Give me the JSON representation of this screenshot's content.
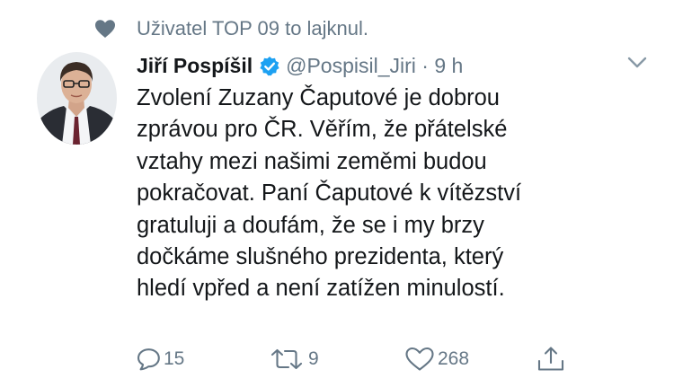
{
  "social_context": {
    "icon": "heart-icon",
    "text": "Uživatel TOP 09 to lajknul."
  },
  "tweet": {
    "author": {
      "display_name": "Jiří Pospíšil",
      "verified": true,
      "handle_time": "@Pospisil_Jiri · 9 h",
      "avatar": "avatar-photo"
    },
    "text_lines": [
      "Zvolení Zuzany Čaputové je dobrou",
      "zprávou pro ČR. Věřím, že přátelské",
      "vztahy mezi našimi zeměmi budou",
      "pokračovat. Paní Čaputové k vítězství",
      "gratuluji a doufám, že se i my brzy",
      "dočkáme slušného prezidenta, který",
      "hledí vpřed a není zatížen minulostí."
    ],
    "actions": {
      "reply_count": "15",
      "retweet_count": "9",
      "like_count": "268"
    }
  },
  "colors": {
    "text": "#14171a",
    "secondary": "#657786",
    "verified": "#1da1f2"
  }
}
